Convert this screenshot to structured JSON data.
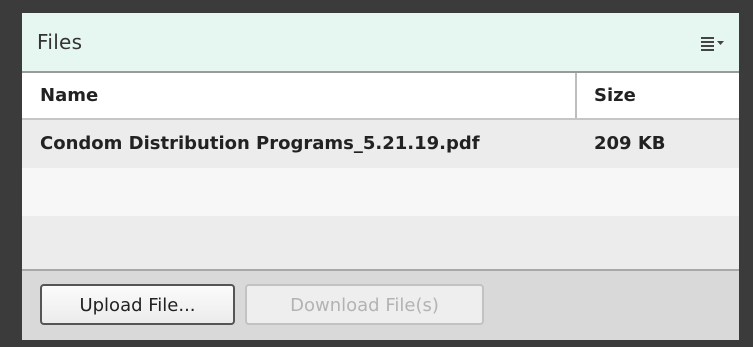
{
  "panel": {
    "title": "Files",
    "menu_icon": "list-menu-icon"
  },
  "table": {
    "columns": [
      "Name",
      "Size"
    ],
    "rows": [
      {
        "name": "Condom Distribution Programs_5.21.19.pdf",
        "size": "209 KB"
      }
    ]
  },
  "footer": {
    "upload_label": "Upload File...",
    "download_label": "Download File(s)",
    "download_enabled": false
  },
  "colors": {
    "header_bg": "#e6f6f1",
    "frame": "#3b3b3b",
    "disabled_text": "#b3b3b3"
  }
}
